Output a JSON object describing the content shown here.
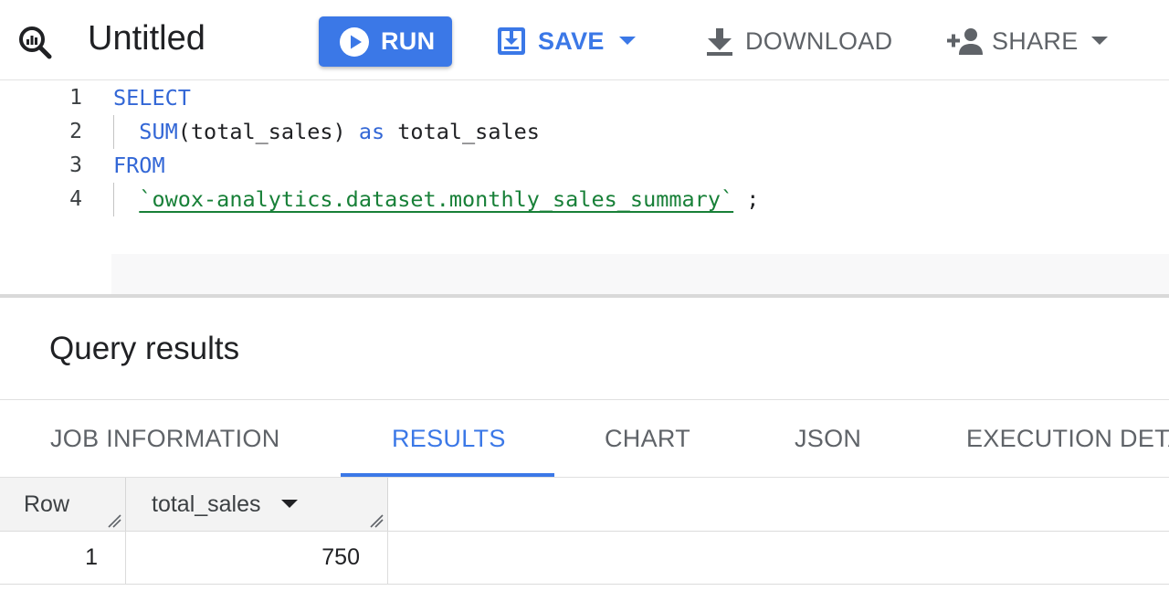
{
  "toolbar": {
    "title": "Untitled",
    "run_label": "RUN",
    "save_label": "SAVE",
    "download_label": "DOWNLOAD",
    "share_label": "SHARE",
    "accent_color": "#3b78e7",
    "icons": {
      "logo": "bigquery-search-icon",
      "run": "play-circle-icon",
      "save": "save-icon",
      "download": "download-icon",
      "share": "person-add-icon",
      "dropdown": "arrow-drop-down-icon"
    }
  },
  "editor": {
    "lines": [
      {
        "number": "1",
        "tokens": [
          {
            "text": "SELECT",
            "type": "keyword"
          }
        ]
      },
      {
        "number": "2",
        "tokens": [
          {
            "text": "SUM",
            "type": "keyword"
          },
          {
            "text": "(total_sales)",
            "type": "plain"
          },
          {
            "text": " as",
            "type": "keyword"
          },
          {
            "text": " total_sales",
            "type": "plain"
          }
        ]
      },
      {
        "number": "3",
        "tokens": [
          {
            "text": "FROM",
            "type": "keyword"
          }
        ]
      },
      {
        "number": "4",
        "tokens": [
          {
            "text": "`owox-analytics.dataset.monthly_sales_summary`",
            "type": "string"
          },
          {
            "text": " ;",
            "type": "plain"
          }
        ]
      }
    ],
    "colors": {
      "keyword": "#3367d6",
      "string": "#188038",
      "plain": "#202124"
    }
  },
  "results": {
    "title": "Query results",
    "tabs": [
      {
        "label": "JOB INFORMATION",
        "active": false
      },
      {
        "label": "RESULTS",
        "active": true
      },
      {
        "label": "CHART",
        "active": false
      },
      {
        "label": "JSON",
        "active": false
      },
      {
        "label": "EXECUTION DETAILS",
        "active": false
      }
    ],
    "table": {
      "columns": [
        "Row",
        "total_sales"
      ],
      "rows": [
        [
          "1",
          "750"
        ]
      ]
    }
  }
}
